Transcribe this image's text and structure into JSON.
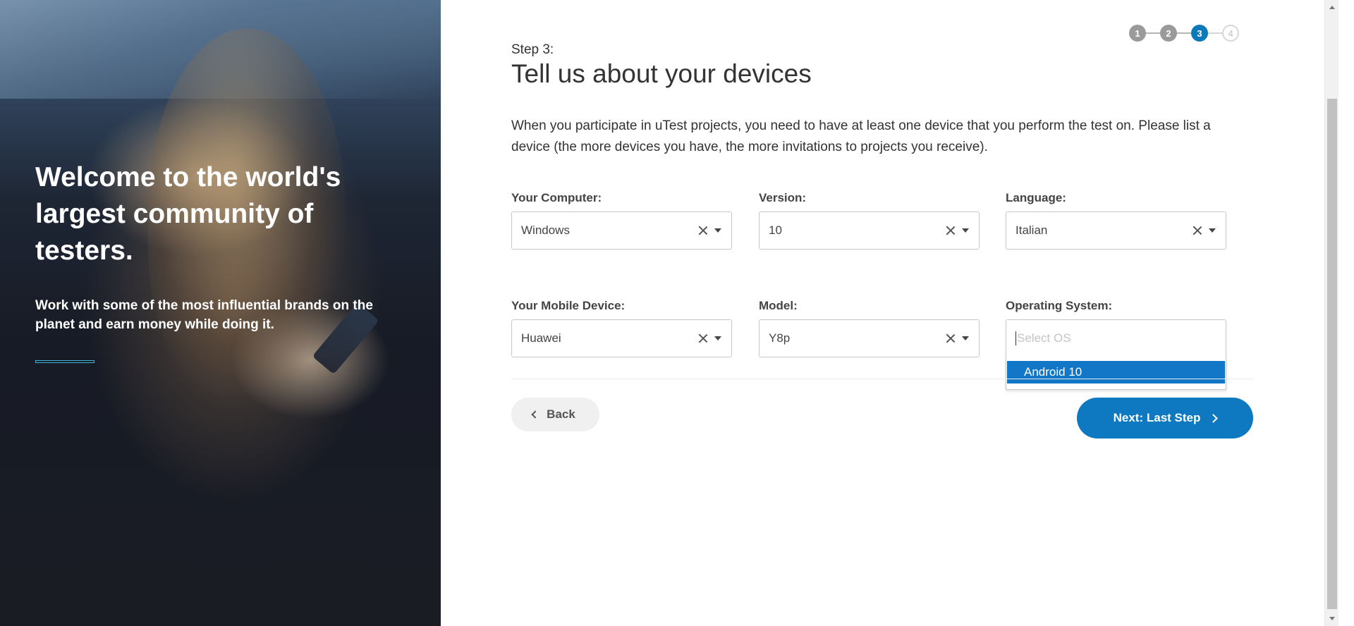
{
  "hero": {
    "title": "Welcome to the world's largest community of testers.",
    "subtitle": "Work with some of the most influential brands on the planet and earn money while doing it."
  },
  "stepper": {
    "steps": [
      "1",
      "2",
      "3",
      "4"
    ],
    "current": 3
  },
  "header": {
    "step_label": "Step 3:",
    "title": "Tell us about your devices"
  },
  "intro": "When you participate in uTest projects, you need to have at least one device that you perform the test on. Please list a device (the more devices you have, the more invitations to projects you receive).",
  "computer": {
    "label": "Your Computer:",
    "os": {
      "value": "Windows"
    },
    "version_label": "Version:",
    "version": {
      "value": "10"
    },
    "language_label": "Language:",
    "language": {
      "value": "Italian"
    }
  },
  "mobile": {
    "label": "Your Mobile Device:",
    "device": {
      "value": "Huawei"
    },
    "model_label": "Model:",
    "model": {
      "value": "Y8p"
    },
    "os_label": "Operating System:",
    "os": {
      "placeholder": "Select OS",
      "options": [
        "Android 10"
      ]
    }
  },
  "buttons": {
    "back": "Back",
    "next": "Next: Last Step"
  },
  "colors": {
    "accent": "#0e79c0",
    "highlight": "#1277c6"
  }
}
